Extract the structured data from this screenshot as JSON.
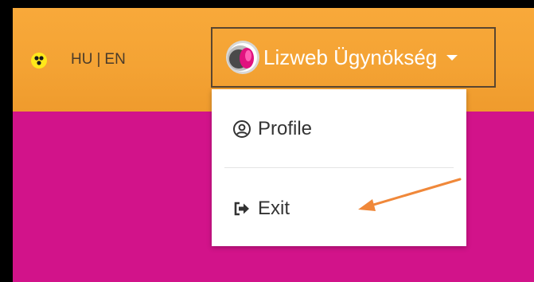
{
  "header": {
    "accessibility_icon": "accessibility-icon",
    "languages": {
      "hu": "HU",
      "separator": "|",
      "en": "EN"
    },
    "user": {
      "name": "Lizweb Ügynökség",
      "avatar": "company-logo-icon",
      "caret": "chevron-down-icon"
    }
  },
  "user_menu": {
    "items": [
      {
        "label": "Profile",
        "icon": "user-circle-icon"
      },
      {
        "label": "Exit",
        "icon": "sign-out-icon"
      }
    ]
  },
  "annotation": {
    "type": "arrow",
    "points_to": "Exit",
    "color": "#f0883a"
  },
  "colors": {
    "page_background": "#d2138a",
    "header_background": "#f4a334",
    "annotation_arrow": "#f0883a"
  }
}
